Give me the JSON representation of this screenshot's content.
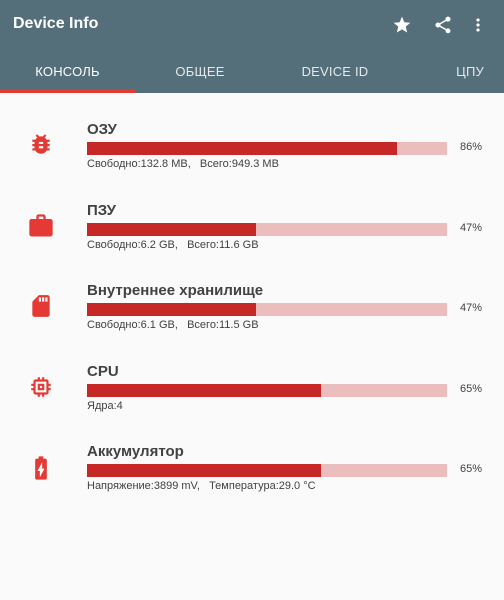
{
  "app": {
    "title": "Device Info",
    "icons": [
      "star-icon",
      "share-icon",
      "more-vert-icon"
    ],
    "colors": {
      "appbar": "#546e7a",
      "accent": "#e53935",
      "bar_fill": "#c62828",
      "bar_track": "#ebbdbd"
    }
  },
  "tabs": [
    {
      "label": "КОНСОЛЬ",
      "active": true
    },
    {
      "label": "ОБЩЕЕ",
      "active": false
    },
    {
      "label": "DEVICE ID",
      "active": false
    },
    {
      "label": "ЦПУ",
      "active": false
    }
  ],
  "items": [
    {
      "icon": "bug-icon",
      "title": "ОЗУ",
      "percent": 86,
      "percent_label": "86%",
      "detail": "Свободно:132.8 MB,   Всего:949.3 MB"
    },
    {
      "icon": "briefcase-icon",
      "title": "ПЗУ",
      "percent": 47,
      "percent_label": "47%",
      "detail": "Свободно:6.2 GB,   Всего:11.6 GB"
    },
    {
      "icon": "sd-card-icon",
      "title": "Внутреннее хранилище",
      "percent": 47,
      "percent_label": "47%",
      "detail": "Свободно:6.1 GB,   Всего:11.5 GB"
    },
    {
      "icon": "cpu-chip-icon",
      "title": "CPU",
      "percent": 65,
      "percent_label": "65%",
      "detail": "Ядра:4"
    },
    {
      "icon": "battery-charging-icon",
      "title": "Аккумулятор",
      "percent": 65,
      "percent_label": "65%",
      "detail": "Напряжение:3899 mV,   Температура:29.0 °C"
    }
  ]
}
